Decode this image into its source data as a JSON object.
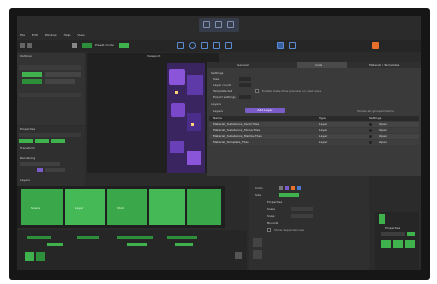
{
  "menu": [
    "File",
    "Edit",
    "Window",
    "Help",
    "View"
  ],
  "toolbar": {
    "mode_label": "Preset mode"
  },
  "left_panel": {
    "title": "Outliner",
    "properties_title": "Properties",
    "sections": [
      "Transform",
      "Rendering",
      "Layers"
    ]
  },
  "viewport": {
    "tab": "Viewport"
  },
  "right_tabs": [
    "General",
    "Cells",
    "Material / Templates"
  ],
  "settings": {
    "title": "Settings",
    "rows": [
      "Size",
      "Layer count",
      "Template list",
      "Export settings"
    ],
    "checkbox_text": "Enable bake-time preview on next save",
    "layers_title": "Layers",
    "layers_button": "Add Layer",
    "layers_hint": "Shows all grouped items"
  },
  "table": {
    "headers": [
      "Name",
      "Type",
      "Settings"
    ],
    "rows": [
      {
        "name": "Material_Substance_Sand-Tiles",
        "type": "Layer",
        "action": "Open"
      },
      {
        "name": "Material_Substance_Stone-Tiles",
        "type": "Layer",
        "action": "Open"
      },
      {
        "name": "Material_Substance_Marble-Tiles",
        "type": "Layer",
        "action": "Open"
      },
      {
        "name": "Material_Template_Tiles",
        "type": "Layer",
        "action": "Open"
      }
    ]
  },
  "timeline": {
    "tiles": [
      "Scene",
      "Layer",
      "Shot"
    ]
  },
  "bottom_props": {
    "title": "Properties",
    "fields": [
      "Color",
      "Size",
      "Scale",
      "Snap",
      "Bounds"
    ],
    "checkbox": "Show dependencies"
  },
  "colors": {
    "accent_green": "#3fb24e",
    "accent_orange": "#e8702a",
    "accent_purple": "#7b5cc9",
    "bg": "#2b2b2b"
  },
  "icons": [
    "viewport-icon",
    "grid-icon",
    "move-icon",
    "rotate-icon",
    "scale-icon",
    "snap-icon",
    "camera-icon",
    "settings-icon",
    "render-icon"
  ]
}
